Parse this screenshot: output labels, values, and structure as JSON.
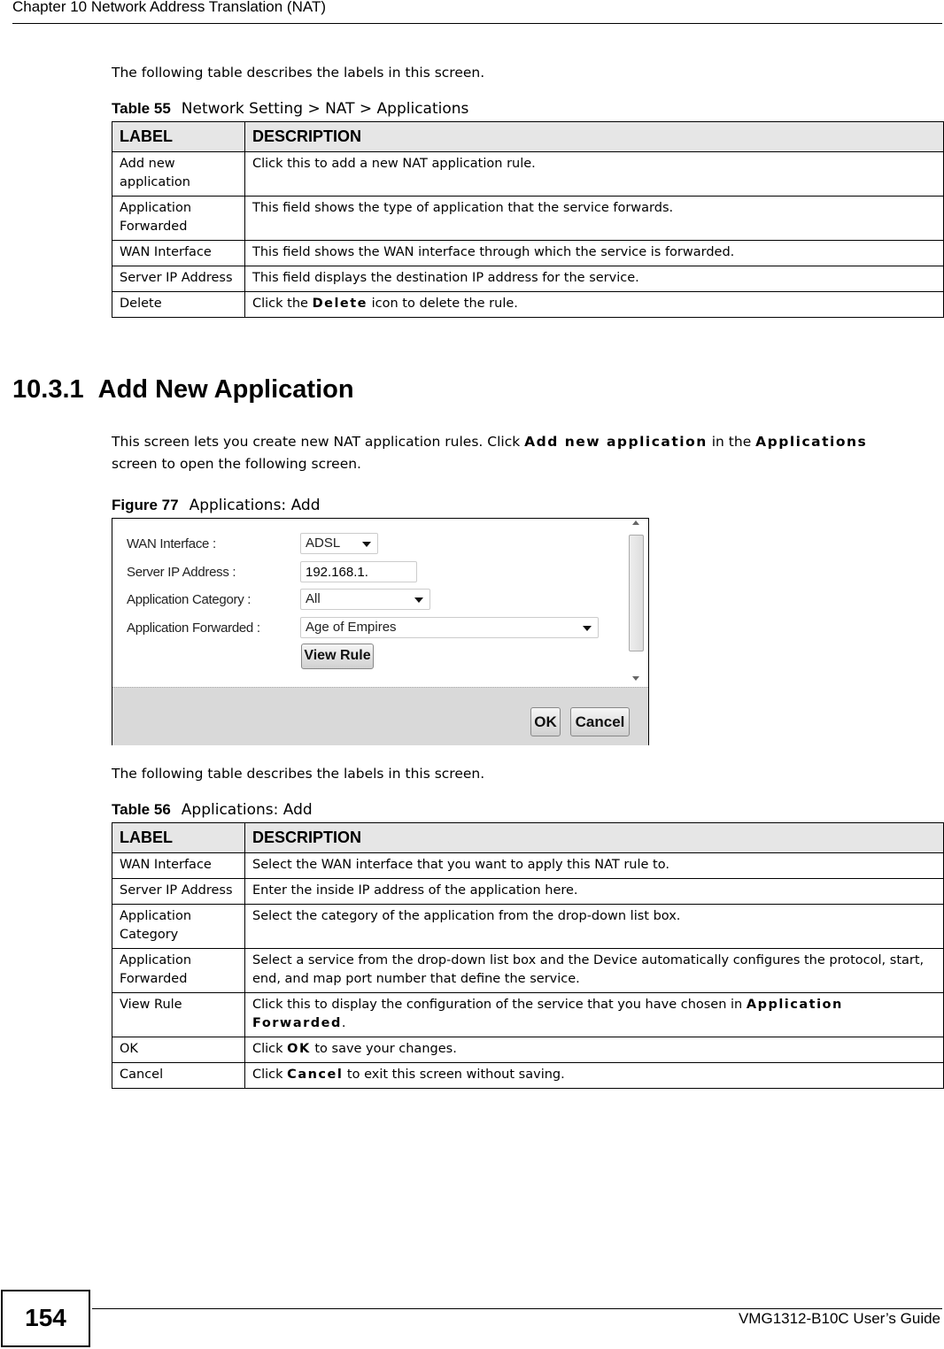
{
  "header": {
    "chapter": "Chapter 10 Network Address Translation (NAT)"
  },
  "intro1": "The following table describes the labels in this screen.",
  "table55": {
    "caption_num": "Table 55",
    "caption_title": "Network Setting > NAT > Applications",
    "headers": [
      "LABEL",
      "DESCRIPTION"
    ],
    "rows": [
      {
        "label": "Add new application",
        "desc": [
          {
            "t": "Click this to add a new NAT application rule."
          }
        ]
      },
      {
        "label": "Application Forwarded",
        "desc": [
          {
            "t": "This field shows the type of application that the service forwards."
          }
        ]
      },
      {
        "label": "WAN Interface",
        "desc": [
          {
            "t": "This field shows the WAN interface through which the service is forwarded."
          }
        ]
      },
      {
        "label": "Server IP Address",
        "desc": [
          {
            "t": "This field displays the destination IP address for the service."
          }
        ]
      },
      {
        "label": "Delete",
        "desc": [
          {
            "t": "Click the "
          },
          {
            "t": "Delete",
            "b": true
          },
          {
            "t": " icon to delete the rule."
          }
        ]
      }
    ]
  },
  "section": {
    "number": "10.3.1",
    "title": "Add New Application"
  },
  "section_para": [
    {
      "t": "This screen lets you create new NAT application rules. Click "
    },
    {
      "t": "Add new application",
      "b": true
    },
    {
      "t": " in the "
    },
    {
      "t": "Applications",
      "b": true
    },
    {
      "t": " screen to open the following screen."
    }
  ],
  "figure": {
    "caption_num": "Figure 77",
    "caption_title": "Applications: Add",
    "wan_label": "WAN Interface :",
    "wan_value": "ADSL",
    "ip_label": "Server IP Address :",
    "ip_value": "192.168.1.",
    "category_label": "Application Category :",
    "category_value": "All",
    "forwarded_label": "Application Forwarded :",
    "forwarded_value": "Age of Empires",
    "view_rule": "View Rule",
    "ok": "OK",
    "cancel": "Cancel"
  },
  "intro2": "The following table describes the labels in this screen.",
  "table56": {
    "caption_num": "Table 56",
    "caption_title": "Applications: Add",
    "headers": [
      "LABEL",
      "DESCRIPTION"
    ],
    "rows": [
      {
        "label": "WAN Interface",
        "desc": [
          {
            "t": "Select the WAN interface that you want to apply this NAT rule to."
          }
        ]
      },
      {
        "label": "Server IP Address",
        "desc": [
          {
            "t": "Enter the inside IP address of the application here."
          }
        ]
      },
      {
        "label": "Application Category",
        "desc": [
          {
            "t": "Select the category of the application from the drop-down list box."
          }
        ]
      },
      {
        "label": "Application Forwarded",
        "desc": [
          {
            "t": "Select a service from the drop-down list box and the Device automatically configures the protocol, start, end, and map port number that define the service."
          }
        ]
      },
      {
        "label": "View Rule",
        "desc": [
          {
            "t": "Click this to display the configuration of the service that you have chosen in "
          },
          {
            "t": "Application Forwarded",
            "b": true
          },
          {
            "t": "."
          }
        ]
      },
      {
        "label": "OK",
        "desc": [
          {
            "t": "Click "
          },
          {
            "t": "OK",
            "b": true
          },
          {
            "t": " to save your changes."
          }
        ]
      },
      {
        "label": "Cancel",
        "desc": [
          {
            "t": "Click "
          },
          {
            "t": "Cancel",
            "b": true
          },
          {
            "t": " to exit this screen without saving."
          }
        ]
      }
    ]
  },
  "footer": {
    "page_number": "154",
    "guide": "VMG1312-B10C User’s Guide"
  }
}
